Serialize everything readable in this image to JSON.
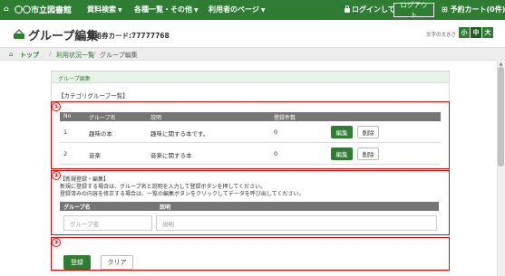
{
  "nav": {
    "library_name": "〇〇市立図書館",
    "items": [
      "資料検索",
      "各種一覧・その他",
      "利用者のページ"
    ],
    "login_status": "ログインしています",
    "logout_label": "ログアウト",
    "cart_label": "予約カート(0件)"
  },
  "header": {
    "title": "グループ編集",
    "card_label": "利用券カード:77777768",
    "fontsize_label": "文字の大きさ",
    "fontsize_small": "小",
    "fontsize_mid": "中",
    "fontsize_large": "大"
  },
  "breadcrumb": [
    "トップ",
    "利用状況一覧",
    "グループ編集"
  ],
  "panel": {
    "title": "グループ編集",
    "category_list_label": "【カテゴリグループ一覧】"
  },
  "table": {
    "headers": [
      "No",
      "グループ名",
      "説明",
      "登録件数"
    ],
    "rows": [
      {
        "no": "1",
        "name": "趣味の本",
        "desc": "趣味に関する本です。",
        "count": "0",
        "edit": "編集",
        "delete": "削除"
      },
      {
        "no": "2",
        "name": "音楽",
        "desc": "音楽に関する本",
        "count": "0",
        "edit": "編集",
        "delete": "削除"
      }
    ]
  },
  "registration": {
    "title": "【新規登録・編集】",
    "line1": "新規に登録する場合は、グループ名と説明を入力して登録ボタンを押してください。",
    "line2": "登録済みの内容を修正する場合は、一覧の編集ボタンをクリックしてデータを呼び出してください。",
    "name_header": "グループ名",
    "desc_header": "説明",
    "name_placeholder": "グループ名",
    "desc_placeholder": "説明"
  },
  "buttons": {
    "register": "登録",
    "clear": "クリア"
  },
  "annotations": [
    "①",
    "②",
    "③"
  ],
  "colors": {
    "brand": "#2e7d32",
    "highlight": "#d01010",
    "table_header": "#757575"
  }
}
